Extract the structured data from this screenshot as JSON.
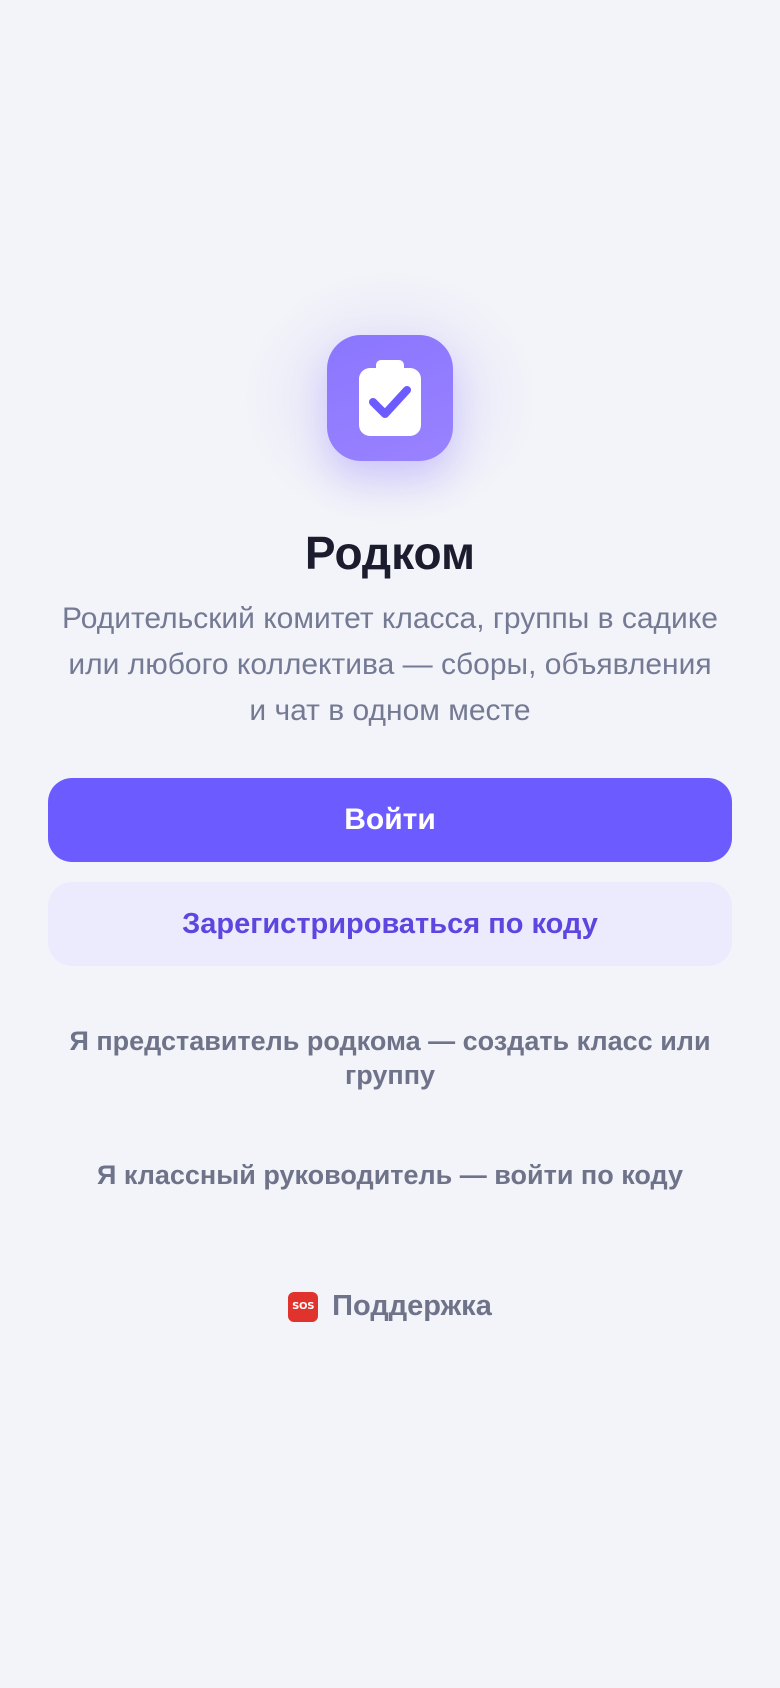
{
  "app": {
    "title": "Родком",
    "subtitle": "Родительский комитет класса, группы в садике или любого коллектива — сборы, объявления и чат в одном месте",
    "logo_icon": "clipboard-check-icon",
    "accent_color": "#6c5cff"
  },
  "actions": {
    "login_label": "Войти",
    "register_label": "Зарегистрироваться по коду",
    "representative_label": "Я представитель родкома — создать класс или группу",
    "teacher_label": "Я классный руководитель — войти по коду"
  },
  "support": {
    "icon": "sos-icon",
    "icon_text": "SOS",
    "label": "Поддержка"
  }
}
